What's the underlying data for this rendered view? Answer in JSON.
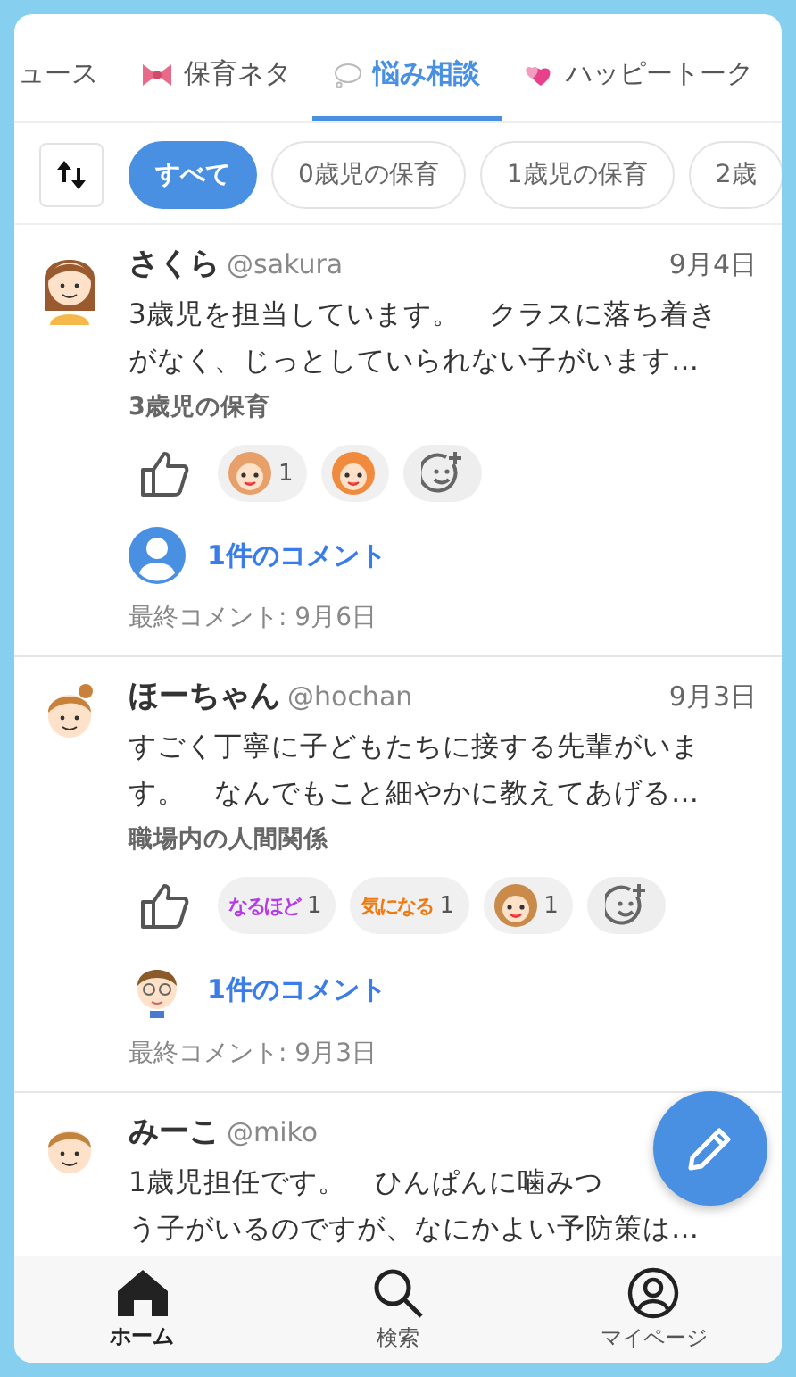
{
  "tabs": [
    {
      "label": "ュース",
      "selected": false
    },
    {
      "label": "保育ネタ",
      "selected": false
    },
    {
      "label": "悩み相談",
      "selected": true
    },
    {
      "label": "ハッピートーク",
      "selected": false
    }
  ],
  "filters": [
    {
      "label": "すべて",
      "selected": true
    },
    {
      "label": "0歳児の保育",
      "selected": false
    },
    {
      "label": "1歳児の保育",
      "selected": false
    },
    {
      "label": "2歳",
      "selected": false
    }
  ],
  "posts": [
    {
      "name": "さくら",
      "handle": "@sakura",
      "date": "9月4日",
      "lines": [
        "3歳児を担当しています。　クラスに落ち着き",
        "がなく、じっとしていられない子がいます…"
      ],
      "tag": "3歳児の保育",
      "reactions": [
        {
          "kind": "face",
          "color": "#e8a06a",
          "count": "1"
        },
        {
          "kind": "face",
          "color": "#f08a3c"
        }
      ],
      "comment_count": "1件のコメント",
      "last_comment": "最終コメント: 9月6日"
    },
    {
      "name": "ほーちゃん",
      "handle": "@hochan",
      "date": "9月3日",
      "lines": [
        "すごく丁寧に子どもたちに接する先輩がいま",
        "す。　なんでもこと細やかに教えてあげる…"
      ],
      "tag": "職場内の人間関係",
      "reactions": [
        {
          "kind": "text",
          "label": "なるほど",
          "color": "#b43be6",
          "count": "1"
        },
        {
          "kind": "text",
          "label": "気になる",
          "color": "#f07a12",
          "count": "1"
        },
        {
          "kind": "face",
          "color": "#c98a4a",
          "count": "1"
        }
      ],
      "comment_count": "1件のコメント",
      "last_comment": "最終コメント: 9月3日"
    },
    {
      "name": "みーこ",
      "handle": "@miko",
      "lines": [
        "1歳児担任です。　ひんぱんに噛みつ",
        "う子がいるのですが、なにかよい予防策は…"
      ]
    }
  ],
  "nav": [
    {
      "label": "ホーム",
      "selected": true
    },
    {
      "label": "検索",
      "selected": false
    },
    {
      "label": "マイページ",
      "selected": false
    }
  ]
}
